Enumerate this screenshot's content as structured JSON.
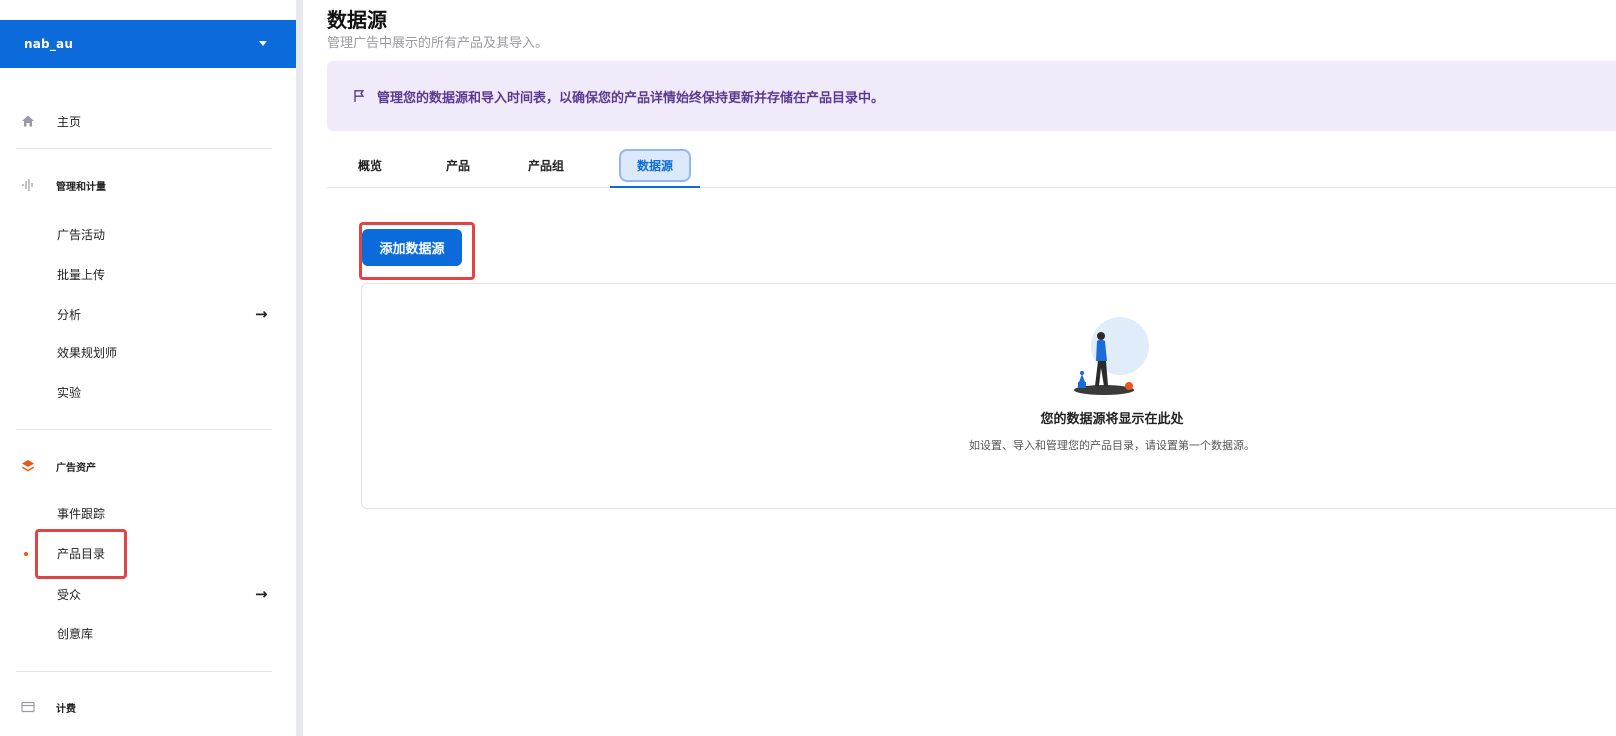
{
  "account": {
    "name": "nab_au"
  },
  "nav": {
    "home": "主页",
    "section_manage": "管理和计量",
    "campaigns": "广告活动",
    "bulk_upload": "批量上传",
    "analytics": "分析",
    "planner": "效果规划师",
    "experiments": "实验",
    "section_assets": "广告资产",
    "event_tracking": "事件跟踪",
    "catalog": "产品目录",
    "audiences": "受众",
    "creative_library": "创意库",
    "section_billing": "计费"
  },
  "page": {
    "title": "数据源",
    "subtitle": "管理广告中展示的所有产品及其导入。",
    "banner_text": "管理您的数据源和导入时间表，以确保您的产品详情始终保持更新并存储在产品目录中。"
  },
  "tabs": [
    {
      "label": "概览"
    },
    {
      "label": "产品"
    },
    {
      "label": "产品组"
    },
    {
      "label": "数据源"
    }
  ],
  "actions": {
    "add_source": "添加数据源"
  },
  "empty_state": {
    "title": "您的数据源将显示在此处",
    "description": "如设置、导入和管理您的产品目录，请设置第一个数据源。"
  },
  "colors": {
    "brand": "#0b6bdb",
    "accent": "#e8581e",
    "highlight": "#e04545"
  }
}
